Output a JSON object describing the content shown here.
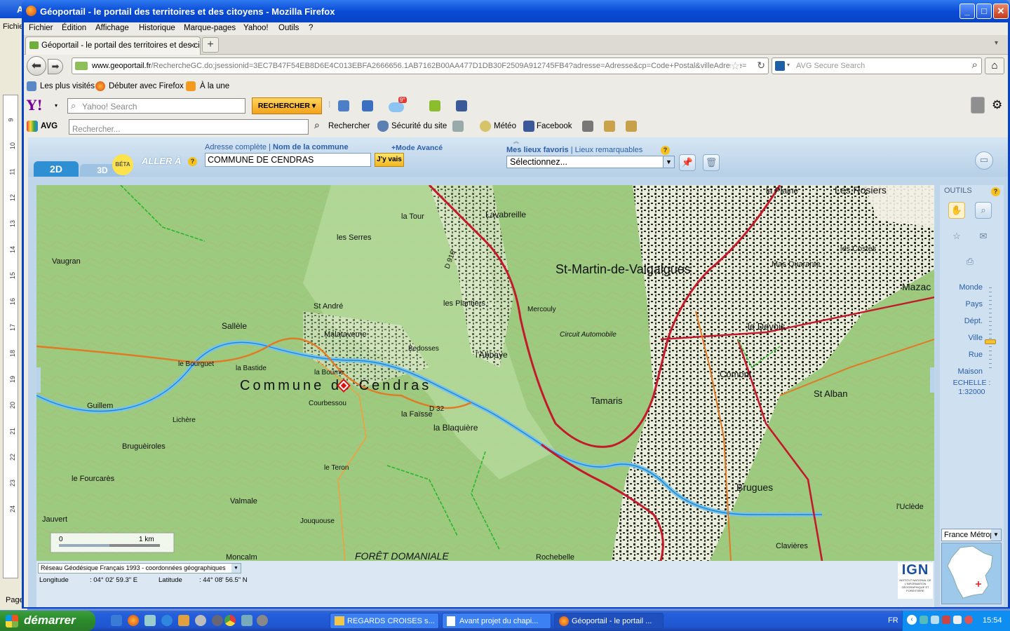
{
  "window": {
    "title": "Géoportail - le portail des territoires et des citoyens - Mozilla Firefox"
  },
  "bg_window": {
    "title": "A",
    "menu": "Fichie",
    "page": "Page",
    "ruler": [
      "9",
      "10",
      "11",
      "12",
      "13",
      "14",
      "15",
      "16",
      "17",
      "18",
      "19",
      "20",
      "21",
      "22",
      "23",
      "24"
    ]
  },
  "menu": [
    "Fichier",
    "Édition",
    "Affichage",
    "Historique",
    "Marque-pages",
    "Yahoo!",
    "Outils",
    "?"
  ],
  "tab": {
    "label": "Géoportail - le portail des territoires et des ci..."
  },
  "nav": {
    "url_host": "www.geoportail.fr",
    "url_path": "/RechercheGC.do;jsessionid=3EC7B47F54EB8D6E4C013EBFA2666656.1AB7162B00AA477D1DB30F2509A912745FB4?adresse=Adresse&cp=Code+Postal&villeAdresse=",
    "search_placeholder": "AVG Secure Search"
  },
  "bookmarks": [
    "Les plus visités",
    "Débuter avec Firefox",
    "À la une"
  ],
  "yahoo": {
    "logo": "Y!",
    "placeholder": "Yahoo! Search",
    "button": "RECHERCHER",
    "weather": "9°"
  },
  "avg": {
    "logo": "AVG",
    "placeholder": "Rechercher...",
    "items": [
      "Rechercher",
      "Sécurité du site",
      "Météo",
      "Facebook"
    ]
  },
  "geoportail": {
    "tab_2d": "2D",
    "tab_3d": "3D",
    "beta": "BÉTA",
    "aller": "ALLER À",
    "addr_full": "Adresse complète",
    "addr_sep": " | ",
    "addr_commune": "Nom de la commune",
    "addr_value": "COMMUNE DE CENDRAS",
    "go_button": "J'y vais",
    "mode_avance": "+Mode Avancé",
    "fav_label": "Mes lieux favoris",
    "fav_sep": " | ",
    "fav_remarkable": "Lieux remarquables",
    "fav_select": "Sélectionnez...",
    "outils": "OUTILS",
    "zoom_levels": [
      "Monde",
      "Pays",
      "Dépt.",
      "Ville",
      "Rue",
      "Maison"
    ],
    "echelle_label": "ECHELLE :",
    "echelle_value": "1:32000",
    "region_select": "France Métropole",
    "projection": "Réseau Géodésique Français 1993 - coordonnées géographiques",
    "lon_label": "Longitude",
    "lon_value": ": 04° 02' 59.3\" E",
    "lat_label": "Latitude",
    "lat_value": ": 44° 08' 56.5\" N",
    "ign": "IGN",
    "ign_sub": "INSTITUT NATIONAL DE L'INFORMATION GÉOGRAPHIQUE ET FORESTIÈRE",
    "scale_0": "0",
    "scale_1": "1 km"
  },
  "map_labels": [
    {
      "t": "Commune de Cendras"
    },
    {
      "t": "St-Martin-de-Valgalgues"
    },
    {
      "t": "Les Rosiers"
    },
    {
      "t": "la Plaine"
    },
    {
      "t": "Mazac"
    },
    {
      "t": "Lavabreille"
    },
    {
      "t": "les Serres"
    },
    {
      "t": "la Tour"
    },
    {
      "t": "Vaugran"
    },
    {
      "t": "Sallèle"
    },
    {
      "t": "Malataverne"
    },
    {
      "t": "St André"
    },
    {
      "t": "les Plantiers"
    },
    {
      "t": "l'Abbaye"
    },
    {
      "t": "Tamaris"
    },
    {
      "t": "la Blaquière"
    },
    {
      "t": "la Faïsse"
    },
    {
      "t": "Bruguèiroles"
    },
    {
      "t": "le Fourcarès"
    },
    {
      "t": "Valmale"
    },
    {
      "t": "Jauvert"
    },
    {
      "t": "Moncalm"
    },
    {
      "t": "FORÊT DOMANIALE"
    },
    {
      "t": "Rochebelle"
    },
    {
      "t": "Brugues"
    },
    {
      "t": "Comont"
    },
    {
      "t": "St Alban"
    },
    {
      "t": "le Devois"
    },
    {
      "t": "Mas Quarante"
    },
    {
      "t": "les Costes"
    },
    {
      "t": "Mercouly"
    },
    {
      "t": "Guillem"
    },
    {
      "t": "Lichère"
    },
    {
      "t": "le Bourguet"
    },
    {
      "t": "la Bastide"
    },
    {
      "t": "Bedosses"
    },
    {
      "t": "la Boume"
    },
    {
      "t": "Courbessou"
    },
    {
      "t": "le Teron"
    },
    {
      "t": "Jouquouse"
    },
    {
      "t": "Clavières"
    },
    {
      "t": "l'Uclède"
    },
    {
      "t": "Circuit Automobile"
    },
    {
      "t": "D 32"
    },
    {
      "t": "D 916"
    }
  ],
  "taskbar": {
    "start": "démarrer",
    "tasks": [
      "REGARDS CROISES s...",
      "Avant projet du chapi...",
      "Géoportail - le portail ..."
    ],
    "lang": "FR",
    "clock": "15:54"
  }
}
